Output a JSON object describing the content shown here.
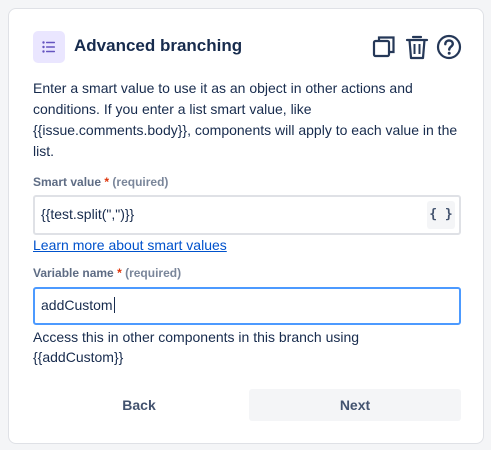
{
  "header": {
    "title": "Advanced branching",
    "icon": "list-icon",
    "icon_bg": "#eae6ff",
    "icon_color": "#6554c0",
    "actions": [
      "copy-icon",
      "trash-icon",
      "help-icon"
    ]
  },
  "description": "Enter a smart value to use it as an object in other actions and conditions. If you enter a list smart value, like {{issue.comments.body}}, components will apply to each value in the list.",
  "smart_value": {
    "label": "Smart value",
    "required_star": "*",
    "required_text": "(required)",
    "value": "{{test.split(\",\")}}",
    "insert_button": "{ }"
  },
  "learn_link": "Learn more about smart values",
  "variable_name": {
    "label": "Variable name",
    "required_star": "*",
    "required_text": "(required)",
    "value": "addCustom"
  },
  "helper_text": "Access this in other components in this branch using {{addCustom}}",
  "buttons": {
    "back": "Back",
    "next": "Next"
  },
  "colors": {
    "focus_border": "#4c9aff",
    "link": "#0052cc",
    "required": "#de350b"
  }
}
